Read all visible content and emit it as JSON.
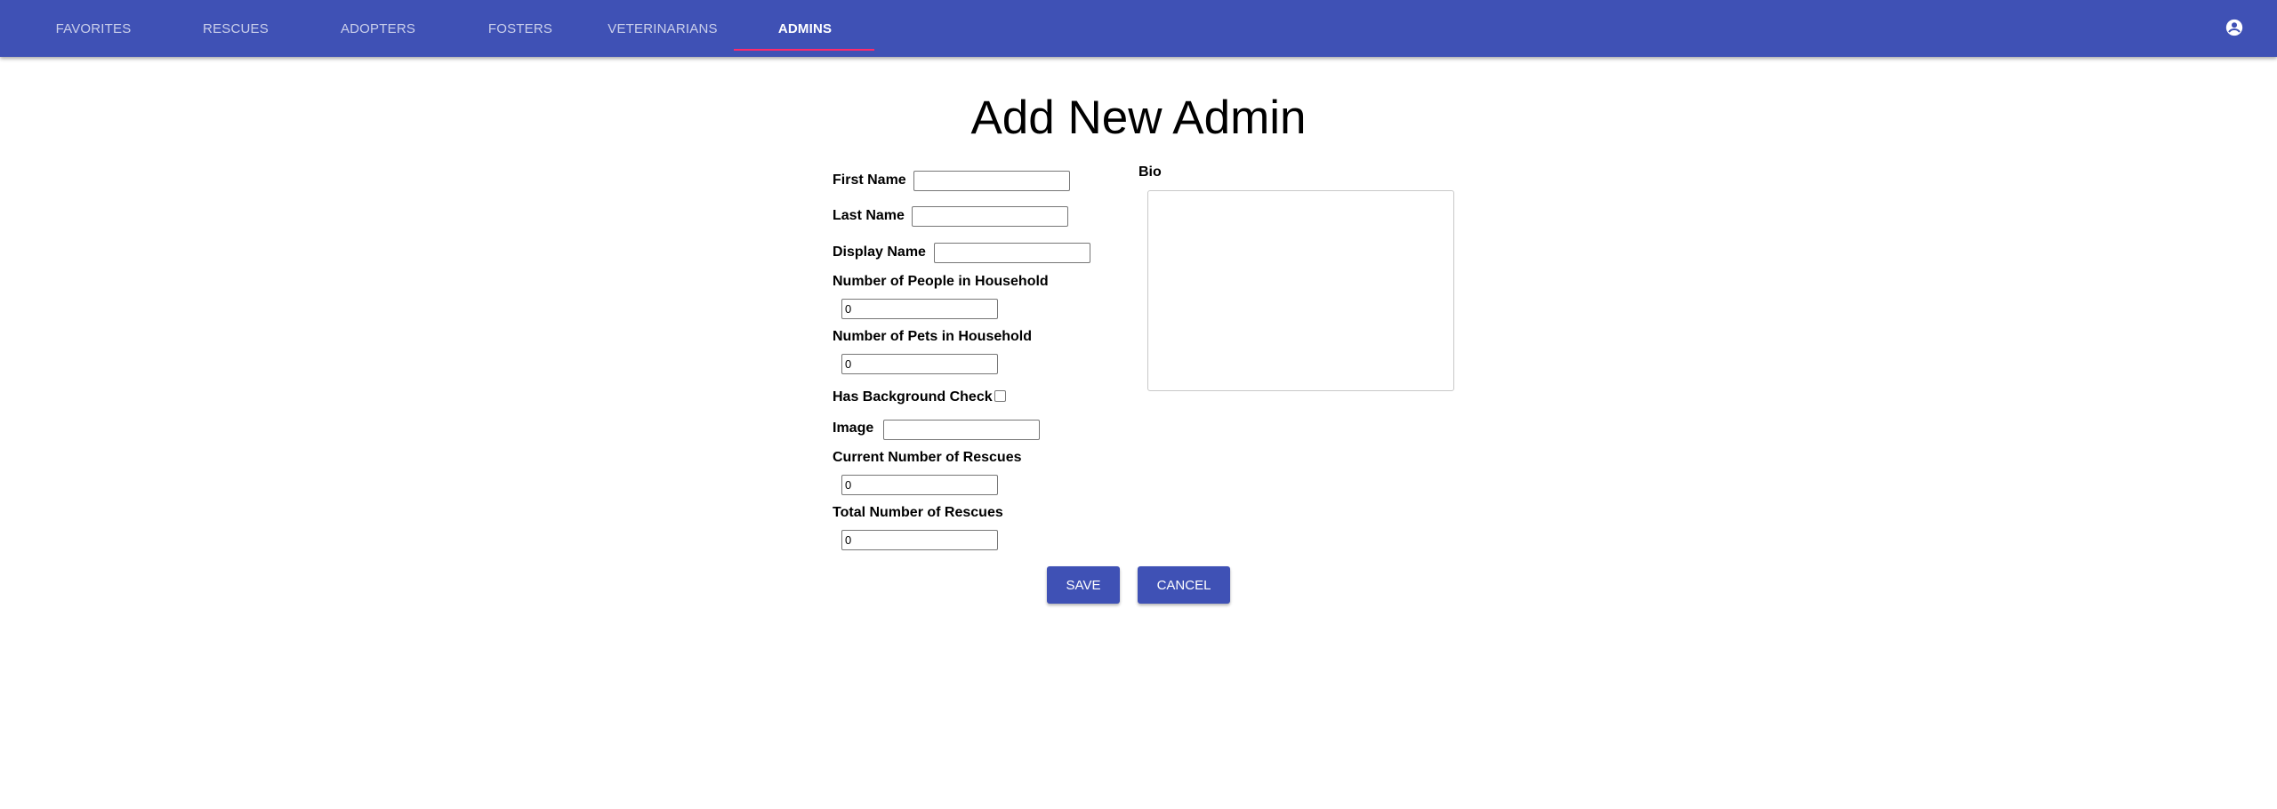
{
  "nav": {
    "tabs": [
      {
        "label": "FAVORITES"
      },
      {
        "label": "RESCUES"
      },
      {
        "label": "ADOPTERS"
      },
      {
        "label": "FOSTERS"
      },
      {
        "label": "VETERINARIANS"
      },
      {
        "label": "ADMINS"
      }
    ],
    "active_tab": "ADMINS",
    "account_icon": "account-circle-icon"
  },
  "page_title": "Add New Admin",
  "form": {
    "first_name": {
      "label": "First Name",
      "value": ""
    },
    "last_name": {
      "label": "Last Name",
      "value": ""
    },
    "display_name": {
      "label": "Display Name",
      "value": ""
    },
    "people_in_household": {
      "label": "Number of People in Household",
      "value": "0"
    },
    "pets_in_household": {
      "label": "Number of Pets in Household",
      "value": "0"
    },
    "background_check": {
      "label": "Has Background Check",
      "checked": false
    },
    "image": {
      "label": "Image",
      "value": ""
    },
    "current_rescues": {
      "label": "Current Number of Rescues",
      "value": "0"
    },
    "total_rescues": {
      "label": "Total Number of Rescues",
      "value": "0"
    },
    "bio": {
      "label": "Bio",
      "value": ""
    }
  },
  "buttons": {
    "save": "SAVE",
    "cancel": "CANCEL"
  },
  "colors": {
    "primary": "#3f51b5",
    "accent": "#ff2a6a"
  }
}
